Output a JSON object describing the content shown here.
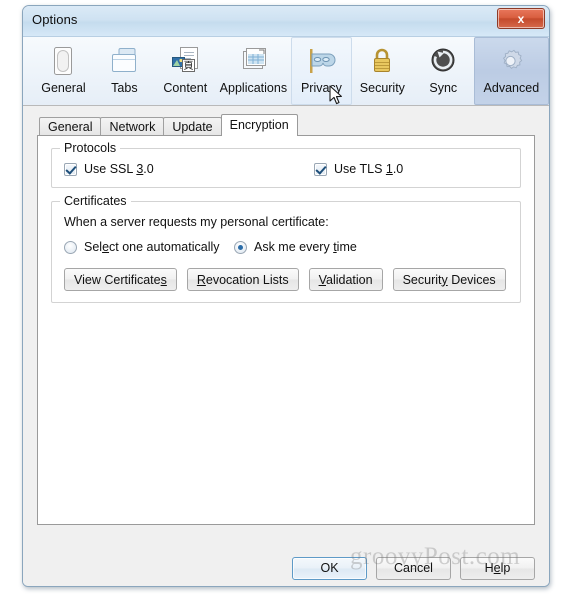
{
  "window": {
    "title": "Options",
    "close_label": "x"
  },
  "toolbar": {
    "items": [
      {
        "label": "General",
        "icon": "general-icon",
        "state": "normal"
      },
      {
        "label": "Tabs",
        "icon": "tabs-icon",
        "state": "normal"
      },
      {
        "label": "Content",
        "icon": "content-icon",
        "state": "normal"
      },
      {
        "label": "Applications",
        "icon": "applications-icon",
        "state": "normal"
      },
      {
        "label": "Privacy",
        "icon": "privacy-mask-icon",
        "state": "hovered"
      },
      {
        "label": "Security",
        "icon": "padlock-icon",
        "state": "normal"
      },
      {
        "label": "Sync",
        "icon": "sync-icon",
        "state": "normal"
      },
      {
        "label": "Advanced",
        "icon": "gear-icon",
        "state": "selected"
      }
    ]
  },
  "tabs": {
    "items": [
      {
        "label": "General",
        "active": false
      },
      {
        "label": "Network",
        "active": false
      },
      {
        "label": "Update",
        "active": false
      },
      {
        "label": "Encryption",
        "active": true
      }
    ]
  },
  "encryption": {
    "protocols": {
      "legend": "Protocols",
      "ssl": {
        "label_prefix": "Use SSL ",
        "accel": "3",
        "label_suffix": ".0",
        "checked": true
      },
      "tls": {
        "label_prefix": "Use TLS ",
        "accel": "1",
        "label_suffix": ".0",
        "checked": true
      }
    },
    "certificates": {
      "legend": "Certificates",
      "prompt": "When a server requests my personal certificate:",
      "radios": [
        {
          "prefix": "Sel",
          "accel": "e",
          "suffix": "ct one automatically",
          "selected": false
        },
        {
          "prefix": "Ask me every ",
          "accel": "t",
          "suffix": "ime",
          "selected": true
        }
      ],
      "buttons": [
        {
          "prefix": "View Certificate",
          "accel": "s",
          "suffix": ""
        },
        {
          "prefix": "",
          "accel": "R",
          "suffix": "evocation Lists"
        },
        {
          "prefix": "",
          "accel": "V",
          "suffix": "alidation"
        },
        {
          "prefix": "Securit",
          "accel": "y",
          "suffix": " Devices"
        }
      ]
    }
  },
  "footer": {
    "ok": "OK",
    "cancel": "Cancel",
    "help_prefix": "H",
    "help_accel": "e",
    "help_suffix": "lp"
  },
  "watermark": "groovyPost.com",
  "colors": {
    "accent": "#2a6ca8",
    "selected_tool_bg": "#bcccE4",
    "close_red": "#c44a2c",
    "window_border": "#8ba6bd"
  }
}
